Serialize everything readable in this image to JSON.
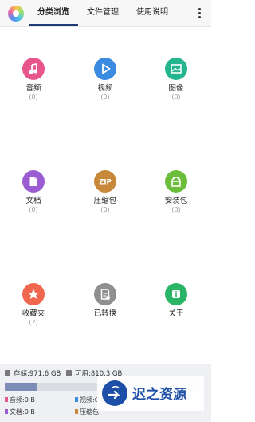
{
  "tabs": [
    {
      "label": "分类浏览",
      "selected": true
    },
    {
      "label": "文件管理",
      "selected": false
    },
    {
      "label": "使用说明",
      "selected": false
    }
  ],
  "categories": [
    {
      "label": "音频",
      "count": "(0)",
      "icon": "music-icon",
      "color": "#e8558a"
    },
    {
      "label": "视频",
      "count": "(0)",
      "icon": "play-icon",
      "color": "#3b8be0"
    },
    {
      "label": "图像",
      "count": "(0)",
      "icon": "image-icon",
      "color": "#23b58f"
    },
    {
      "label": "文档",
      "count": "(0)",
      "icon": "document-icon",
      "color": "#9a5cd0"
    },
    {
      "label": "压缩包",
      "count": "(0)",
      "icon": "zip-icon",
      "icon_text": "ZIP",
      "color": "#c7883a"
    },
    {
      "label": "安装包",
      "count": "(0)",
      "icon": "android-icon",
      "color": "#6bbd3a"
    },
    {
      "label": "收藏夹",
      "count": "(2)",
      "icon": "star-icon",
      "color": "#f0664e"
    },
    {
      "label": "已转换",
      "count": "",
      "icon": "convert-icon",
      "color": "#8f8f8f"
    },
    {
      "label": "关于",
      "count": "",
      "icon": "info-icon",
      "color": "#2ab566"
    }
  ],
  "storage": {
    "storage_label": "存储:971.6 GB",
    "available_label": "可用:810.3 GB",
    "used_fraction": 0.166,
    "fill_color": "#7d8db8",
    "legend": [
      {
        "label": "音频:0 B",
        "color": "#e8558a"
      },
      {
        "label": "视频:0 B",
        "color": "#3b8be0"
      },
      {
        "label": "文档:0 B",
        "color": "#9a5cd0"
      },
      {
        "label": "压缩包",
        "color": "#c7883a"
      }
    ]
  },
  "watermark": {
    "text": "迟之资源",
    "color": "#1d4fa8"
  }
}
